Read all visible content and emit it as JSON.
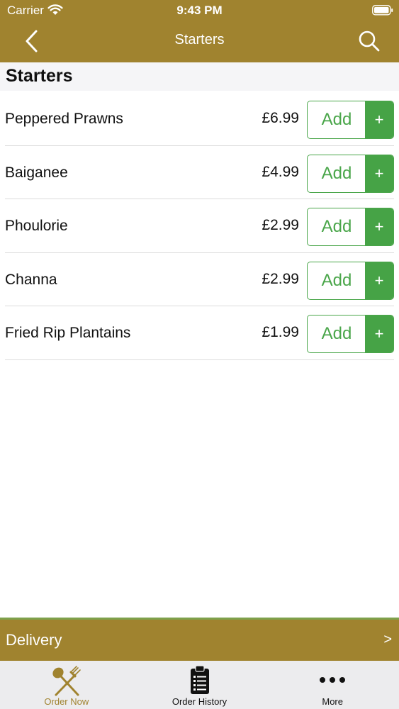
{
  "status_bar": {
    "carrier": "Carrier",
    "time": "9:43 PM"
  },
  "nav": {
    "title": "Starters"
  },
  "section": {
    "title": "Starters"
  },
  "items": [
    {
      "name": "Peppered Prawns",
      "price": "£6.99",
      "add_label": "Add",
      "plus_label": "+"
    },
    {
      "name": "Baiganee",
      "price": "£4.99",
      "add_label": "Add",
      "plus_label": "+"
    },
    {
      "name": "Phoulorie",
      "price": "£2.99",
      "add_label": "Add",
      "plus_label": "+"
    },
    {
      "name": "Channa",
      "price": "£2.99",
      "add_label": "Add",
      "plus_label": "+"
    },
    {
      "name": "Fried Rip Plantains",
      "price": "£1.99",
      "add_label": "Add",
      "plus_label": "+"
    }
  ],
  "delivery": {
    "label": "Delivery",
    "arrow": ">"
  },
  "tabs": [
    {
      "label": "Order Now",
      "icon": "fork-spoon-icon",
      "active": true
    },
    {
      "label": "Order History",
      "icon": "clipboard-list-icon",
      "active": false
    },
    {
      "label": "More",
      "icon": "more-dots-icon",
      "active": false
    }
  ],
  "colors": {
    "brand": "#a0832f",
    "accent_green": "#46a346",
    "tab_bar_bg": "#ececee"
  }
}
